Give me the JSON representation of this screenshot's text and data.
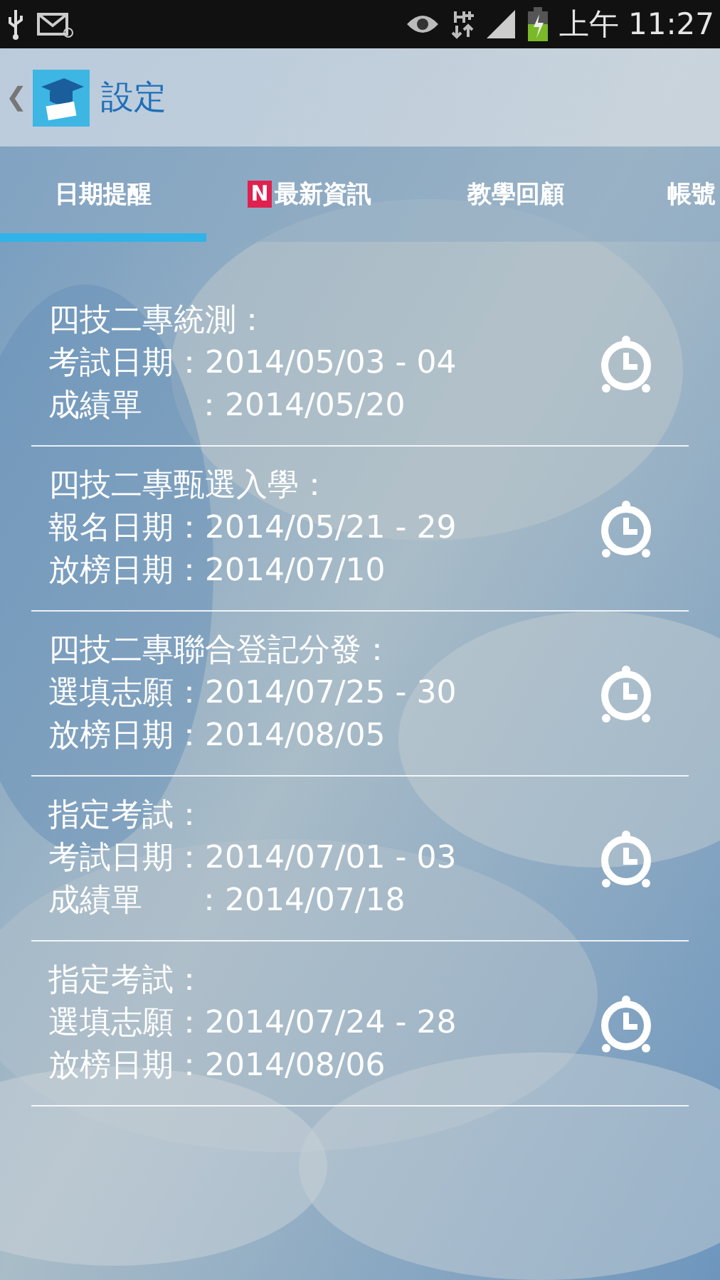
{
  "status_bar": {
    "time": "上午 11:27"
  },
  "action_bar": {
    "title": "設定",
    "back": "❮"
  },
  "tabs": [
    {
      "label": "日期提醒",
      "selected": true
    },
    {
      "label": "最新資訊",
      "badge": "N",
      "selected": false
    },
    {
      "label": "教學回顧",
      "selected": false
    },
    {
      "label": "帳號",
      "selected": false
    }
  ],
  "reminders": [
    {
      "title": "四技二專統測：",
      "lines": [
        "考試日期：2014/05/03 - 04",
        "成績單　  ：2014/05/20"
      ]
    },
    {
      "title": "四技二專甄選入學：",
      "lines": [
        "報名日期：2014/05/21 - 29",
        "放榜日期：2014/07/10"
      ]
    },
    {
      "title": "四技二專聯合登記分發：",
      "lines": [
        "選填志願：2014/07/25 - 30",
        "放榜日期：2014/08/05"
      ]
    },
    {
      "title": "指定考試：",
      "lines": [
        "考試日期：2014/07/01 - 03",
        "成績單　  ：2014/07/18"
      ]
    },
    {
      "title": "指定考試：",
      "lines": [
        "選填志願：2014/07/24 - 28",
        "放榜日期：2014/08/06"
      ]
    }
  ]
}
